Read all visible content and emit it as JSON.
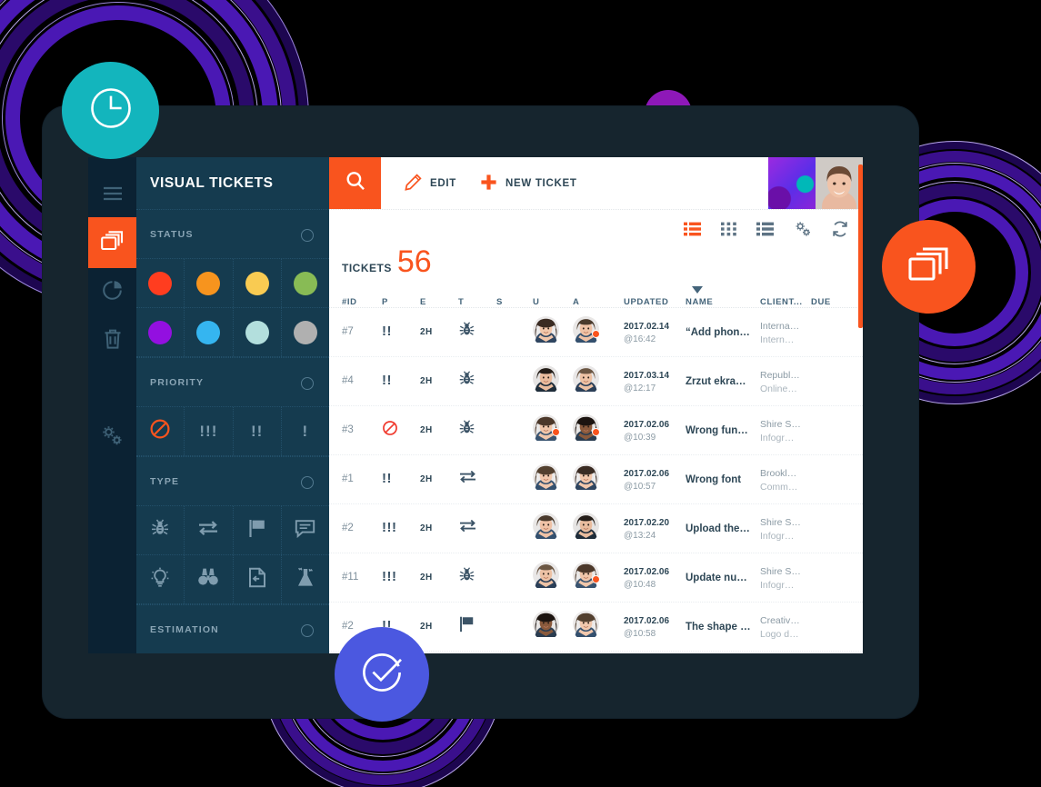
{
  "app": {
    "title": "VISUAL TICKETS",
    "logo_icon": "fluid-logo-icon"
  },
  "rail": {
    "items": [
      {
        "name": "menu",
        "icon": "hamburger-icon",
        "active": false
      },
      {
        "name": "tickets",
        "icon": "cards-stack-icon",
        "active": true
      },
      {
        "name": "reports",
        "icon": "pie-chart-icon",
        "active": false
      },
      {
        "name": "trash",
        "icon": "trash-icon",
        "active": false
      },
      {
        "name": "settings",
        "icon": "gears-icon",
        "active": false
      }
    ]
  },
  "filters": {
    "status": {
      "label": "STATUS",
      "colors": [
        "#ff3d1f",
        "#f7941e",
        "#f9cb52",
        "#88bb55",
        "#9310e0",
        "#35b5f0",
        "#b3dfdd",
        "#b0b0b0"
      ]
    },
    "priority": {
      "label": "PRIORITY",
      "items": [
        {
          "name": "blocker",
          "glyph": "blocked-icon"
        },
        {
          "name": "critical",
          "glyph": "!!!"
        },
        {
          "name": "major",
          "glyph": "!!"
        },
        {
          "name": "minor",
          "glyph": "!"
        }
      ]
    },
    "type": {
      "label": "TYPE",
      "items": [
        {
          "name": "bug",
          "glyph": "bug-icon"
        },
        {
          "name": "change",
          "glyph": "exchange-icon"
        },
        {
          "name": "milestone",
          "glyph": "flag-icon"
        },
        {
          "name": "comment",
          "glyph": "comment-icon"
        },
        {
          "name": "idea",
          "glyph": "lightbulb-icon"
        },
        {
          "name": "review",
          "glyph": "binoculars-icon"
        },
        {
          "name": "document",
          "glyph": "page-icon"
        },
        {
          "name": "experiment",
          "glyph": "flask-icon"
        }
      ]
    },
    "estimation": {
      "label": "ESTIMATION"
    }
  },
  "toolbar": {
    "search_icon": "search-icon",
    "edit_label": "EDIT",
    "edit_icon": "pencil-icon",
    "new_ticket_label": "NEW TICKET",
    "new_ticket_icon": "plus-icon",
    "avatar": "user-avatar"
  },
  "viewbar": {
    "items": [
      {
        "name": "list-view",
        "icon": "list-view-icon",
        "active": true
      },
      {
        "name": "grid-view",
        "icon": "grid-view-icon",
        "active": false
      },
      {
        "name": "compact-view",
        "icon": "compact-list-icon",
        "active": false
      },
      {
        "name": "settings",
        "icon": "gears-icon",
        "active": false
      },
      {
        "name": "refresh",
        "icon": "refresh-icon",
        "active": false
      }
    ]
  },
  "summary": {
    "label": "TICKETS",
    "count": "56"
  },
  "table": {
    "headers": [
      "#ID",
      "P",
      "E",
      "T",
      "S",
      "U",
      "A",
      "UPDATED",
      "NAME",
      "CLIENT...",
      "DUE"
    ],
    "sort_column": "NAME",
    "sort_icon": "caret-down-icon",
    "rows": [
      {
        "id": "#7",
        "priority": "!!",
        "est": "2H",
        "type": "bug-icon",
        "status": "#88bb55",
        "user_badge": false,
        "assignee_badge": true,
        "date": "2017.02.14",
        "time": "@16:42",
        "name": "“Add phon…",
        "client": "Interna…",
        "client_sub": "Intern…",
        "due": ""
      },
      {
        "id": "#4",
        "priority": "!!",
        "est": "2H",
        "type": "bug-icon",
        "status": "#f9cb52",
        "user_badge": false,
        "assignee_badge": false,
        "date": "2017.03.14",
        "time": "@12:17",
        "name": "Zrzut ekra…",
        "client": "Republ…",
        "client_sub": "Online…",
        "due": ""
      },
      {
        "id": "#3",
        "priority": "blocked-icon",
        "est": "2H",
        "type": "bug-icon",
        "status": "#f7941e",
        "user_badge": true,
        "assignee_badge": true,
        "date": "2017.02.06",
        "time": "@10:39",
        "name": "Wrong fun…",
        "client": "Shire S…",
        "client_sub": "Infogr…",
        "due": ""
      },
      {
        "id": "#1",
        "priority": "!!",
        "est": "2H",
        "type": "exchange-icon",
        "status": "#f7941e",
        "user_badge": false,
        "assignee_badge": false,
        "date": "2017.02.06",
        "time": "@10:57",
        "name": "Wrong font",
        "client": "Brookl…",
        "client_sub": "Comm…",
        "due": ""
      },
      {
        "id": "#2",
        "priority": "!!!",
        "est": "2H",
        "type": "exchange-icon",
        "status": "#f9cb52",
        "user_badge": false,
        "assignee_badge": false,
        "date": "2017.02.20",
        "time": "@13:24",
        "name": "Upload the…",
        "client": "Shire S…",
        "client_sub": "Infogr…",
        "due": ""
      },
      {
        "id": "#11",
        "priority": "!!!",
        "est": "2H",
        "type": "bug-icon",
        "status": "#ff3d1f",
        "user_badge": false,
        "assignee_badge": true,
        "date": "2017.02.06",
        "time": "@10:48",
        "name": "Update nu…",
        "client": "Shire S…",
        "client_sub": "Infogr…",
        "due": ""
      },
      {
        "id": "#2",
        "priority": "!!",
        "est": "2H",
        "type": "flag-icon",
        "status": "#9310e0",
        "user_badge": false,
        "assignee_badge": false,
        "date": "2017.02.06",
        "time": "@10:58",
        "name": "The shape …",
        "client": "Creativ…",
        "client_sub": "Logo d…",
        "due": ""
      }
    ]
  },
  "decorations": {
    "badges": [
      {
        "name": "clock-badge",
        "icon": "clock-icon",
        "color": "#13b5bd"
      },
      {
        "name": "cards-badge",
        "icon": "cards-stack-icon",
        "color": "#f9541e"
      },
      {
        "name": "check-badge",
        "icon": "check-circle-icon",
        "color": "#4b58e0"
      },
      {
        "name": "dome-shape",
        "icon": "half-circle",
        "color": "#8e18b8"
      }
    ],
    "ring_color": "#4a14a8",
    "ring_color_dark": "#2a0a6a"
  }
}
